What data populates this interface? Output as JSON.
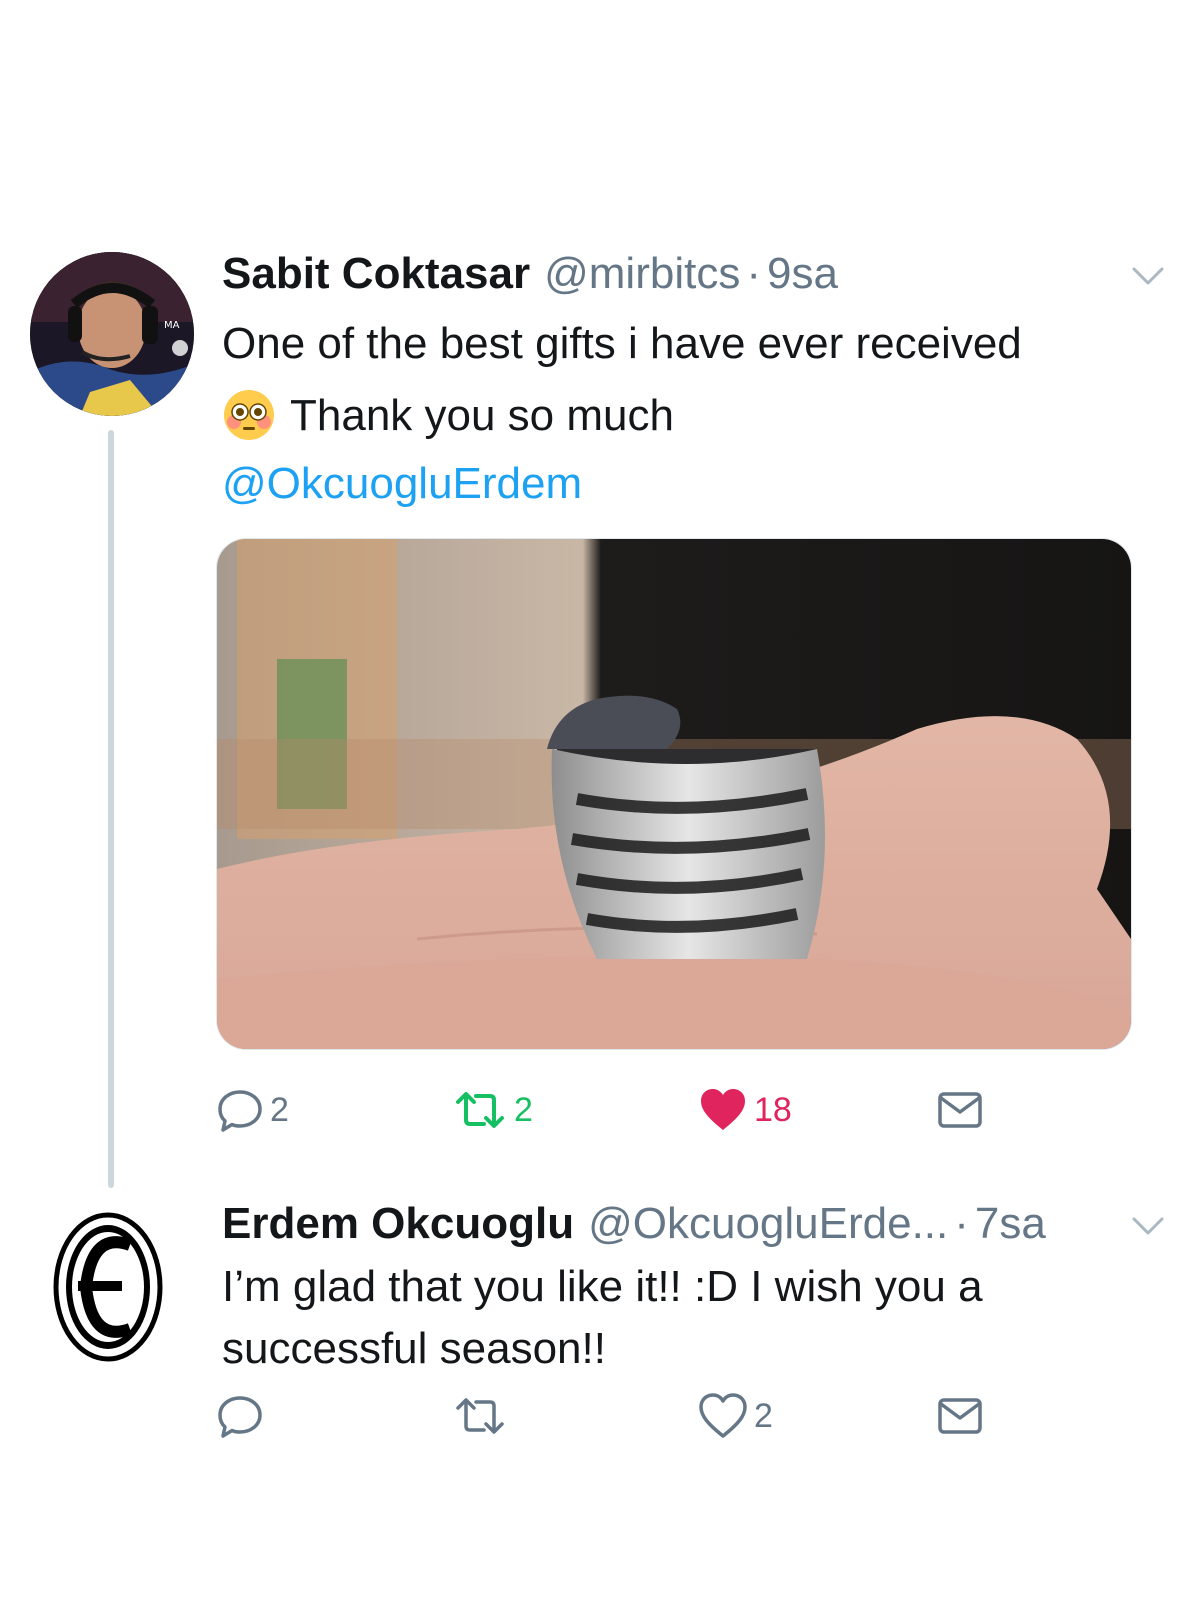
{
  "thread": {
    "tweets": [
      {
        "display_name": "Sabit Coktasar",
        "handle": "@mirbitcs",
        "separator": "·",
        "time": "9sa",
        "text_line1": "One of the best gifts i have ever received",
        "emoji": "flushed-face-emoji",
        "text_line2": "Thank you so much",
        "mention": "@OkcuogluErdem",
        "media_description_icon": "ring-photo",
        "actions": {
          "reply_count": "2",
          "retweet_count": "2",
          "like_count": "18",
          "liked": true,
          "retweeted": true
        }
      },
      {
        "display_name": "Erdem Okcuoglu",
        "handle": "@OkcuogluErde...",
        "separator": "·",
        "time": "7sa",
        "text": "I’m glad that you like it!! :D I wish you a successful season!!",
        "actions": {
          "reply_count": "",
          "retweet_count": "",
          "like_count": "2",
          "liked": false,
          "retweeted": false
        }
      }
    ]
  },
  "icons": {
    "reply": "reply-bubble-icon",
    "retweet": "retweet-icon",
    "like": "heart-icon",
    "dm": "envelope-icon",
    "caret": "chevron-down-icon"
  },
  "colors": {
    "text": "#14171a",
    "secondary": "#657786",
    "link": "#1da1f2",
    "retweet_active": "#17bf63",
    "like_active": "#e0245e",
    "thread_line": "#ccd6dd"
  }
}
